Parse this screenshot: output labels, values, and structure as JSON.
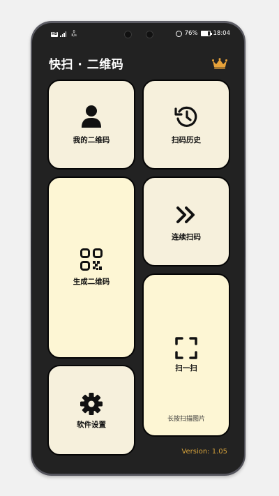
{
  "status_bar": {
    "network_speed_value": "0",
    "network_speed_unit": "K/s",
    "battery": "76%",
    "time": "18:04",
    "battery_level": 0.76
  },
  "app": {
    "title": "快扫 · 二维码",
    "crown_icon": "crown-icon",
    "accent_color": "#e8a33a"
  },
  "tiles": {
    "my_qr": {
      "label": "我的二维码",
      "icon": "user-icon"
    },
    "history": {
      "label": "扫码历史",
      "icon": "history-icon"
    },
    "continuous": {
      "label": "连续扫码",
      "icon": "double-chevron-icon"
    },
    "generate": {
      "label": "生成二维码",
      "icon": "qr-code-icon"
    },
    "scan": {
      "label": "扫一扫",
      "hint": "长按扫描图片",
      "icon": "scan-frame-icon"
    },
    "settings": {
      "label": "软件设置",
      "icon": "gear-icon"
    }
  },
  "footer": {
    "version": "Version: 1.05"
  },
  "colors": {
    "card_beige": "#f6f0dc",
    "card_yellow": "#fdf6d4",
    "background": "#222222",
    "version_text": "#d6a23b"
  }
}
